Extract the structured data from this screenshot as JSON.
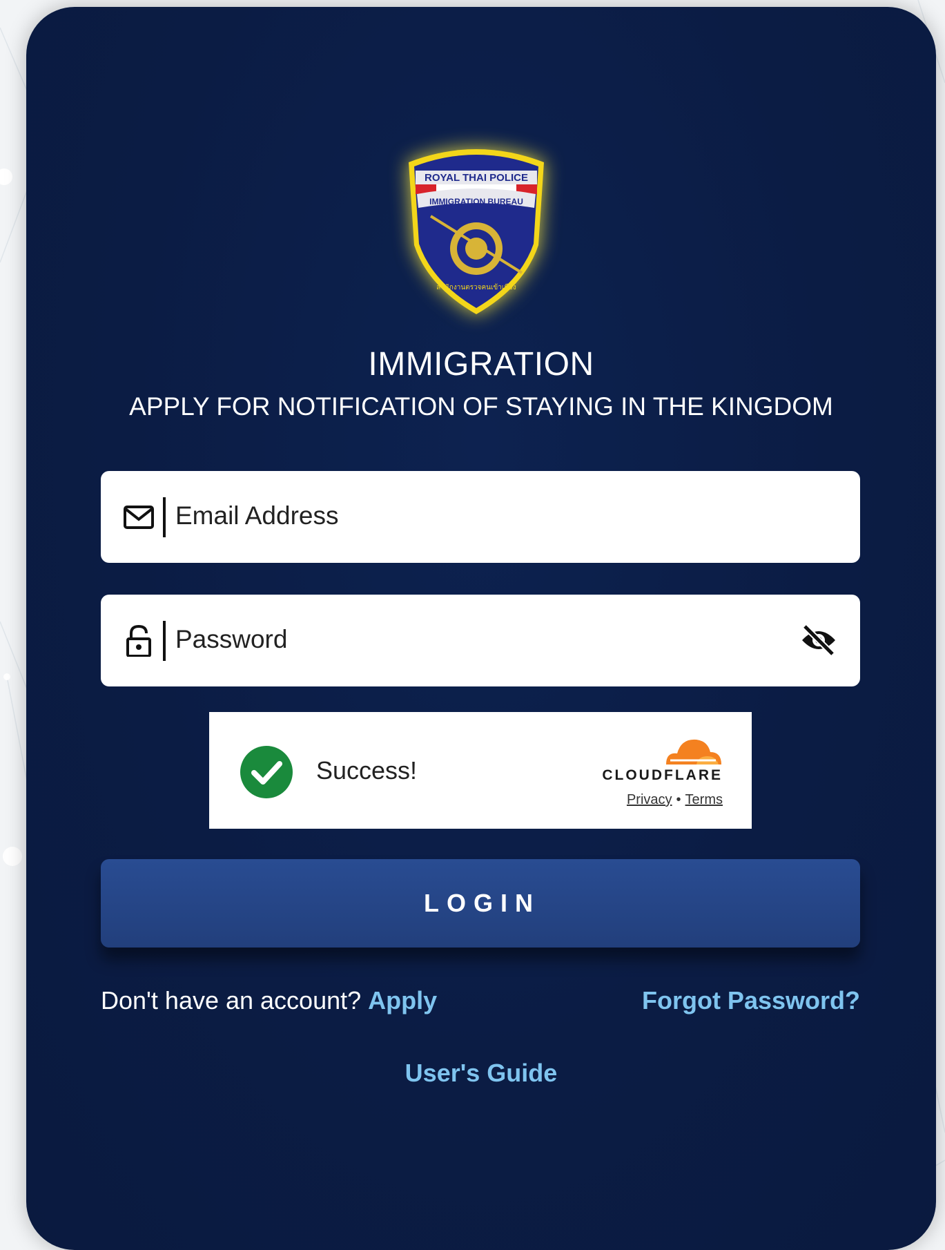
{
  "colors": {
    "card_background": "#0b1c44",
    "page_background": "#f2f4f6",
    "login_button": "#2a4b8d",
    "link": "#7fc4ef",
    "captcha_success": "#1a8a3c",
    "cloudflare_orange": "#f48120"
  },
  "emblem": {
    "top_banner": "ROYAL THAI POLICE",
    "middle_banner": "IMMIGRATION BUREAU",
    "thai_text": "สำนักงานตรวจคนเข้าเมือง"
  },
  "header": {
    "title": "IMMIGRATION",
    "subtitle": "APPLY FOR NOTIFICATION OF STAYING IN THE KINGDOM"
  },
  "form": {
    "email": {
      "placeholder": "Email Address",
      "value": "",
      "icon": "envelope-icon"
    },
    "password": {
      "placeholder": "Password",
      "value": "",
      "icon": "lock-icon",
      "toggle_icon": "eye-slash-icon"
    }
  },
  "captcha": {
    "status_text": "Success!",
    "status_icon": "check-circle-icon",
    "brand": "CLOUDFLARE",
    "privacy_label": "Privacy",
    "separator": "•",
    "terms_label": "Terms"
  },
  "actions": {
    "login_label": "LOGIN",
    "no_account_text": "Don't have an account?",
    "apply_label": "Apply",
    "forgot_label": "Forgot Password?",
    "guide_label": "User's Guide"
  }
}
